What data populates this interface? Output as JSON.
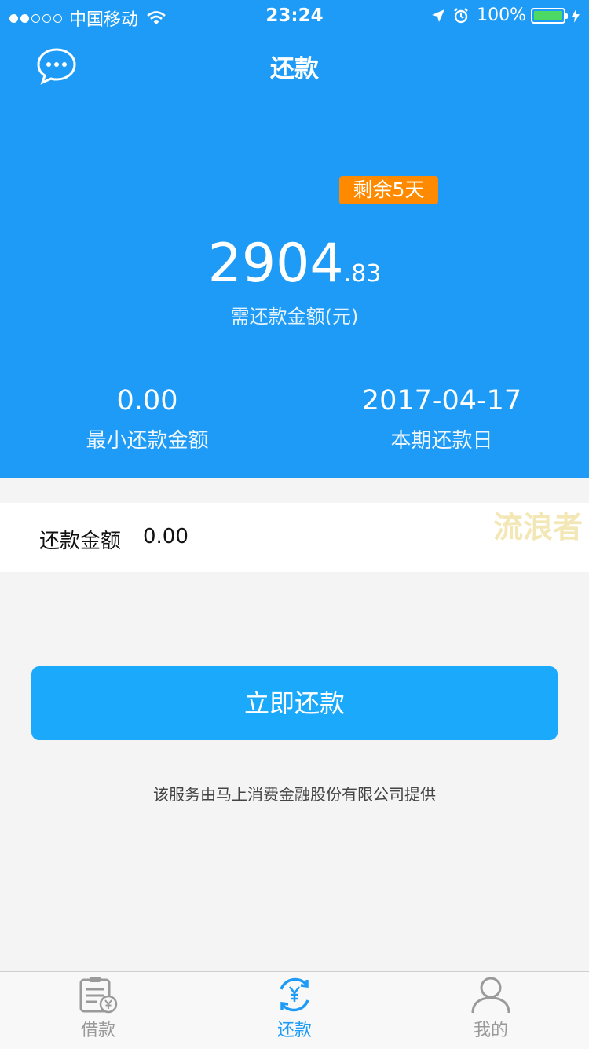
{
  "status_bar": {
    "carrier": "中国移动",
    "time": "23:24",
    "battery": "100%",
    "signal_bars": 2
  },
  "header": {
    "title": "还款",
    "left_icon": "chat-bubble-icon"
  },
  "summary": {
    "remaining_badge": "剩余5天",
    "amount_integer": "2904",
    "amount_decimal": ".83",
    "amount_label": "需还款金额(元)",
    "min_amount": "0.00",
    "min_amount_label": "最小还款金额",
    "due_date": "2017-04-17",
    "due_date_label": "本期还款日"
  },
  "payment": {
    "label": "还款金额",
    "value": "0.00"
  },
  "watermark": "流浪者",
  "action": {
    "pay_button": "立即还款"
  },
  "footer_note": "该服务由马上消费金融股份有限公司提供",
  "tabs": [
    {
      "label": "借款",
      "icon": "loan-document-icon",
      "active": false
    },
    {
      "label": "还款",
      "icon": "repay-yen-cycle-icon",
      "active": true
    },
    {
      "label": "我的",
      "icon": "profile-person-icon",
      "active": false
    }
  ],
  "colors": {
    "primary_blue": "#1d9bf6",
    "button_blue": "#1aa9fb",
    "badge_orange": "#ff8a00",
    "battery_green": "#4cd964",
    "background": "#f4f4f4"
  }
}
